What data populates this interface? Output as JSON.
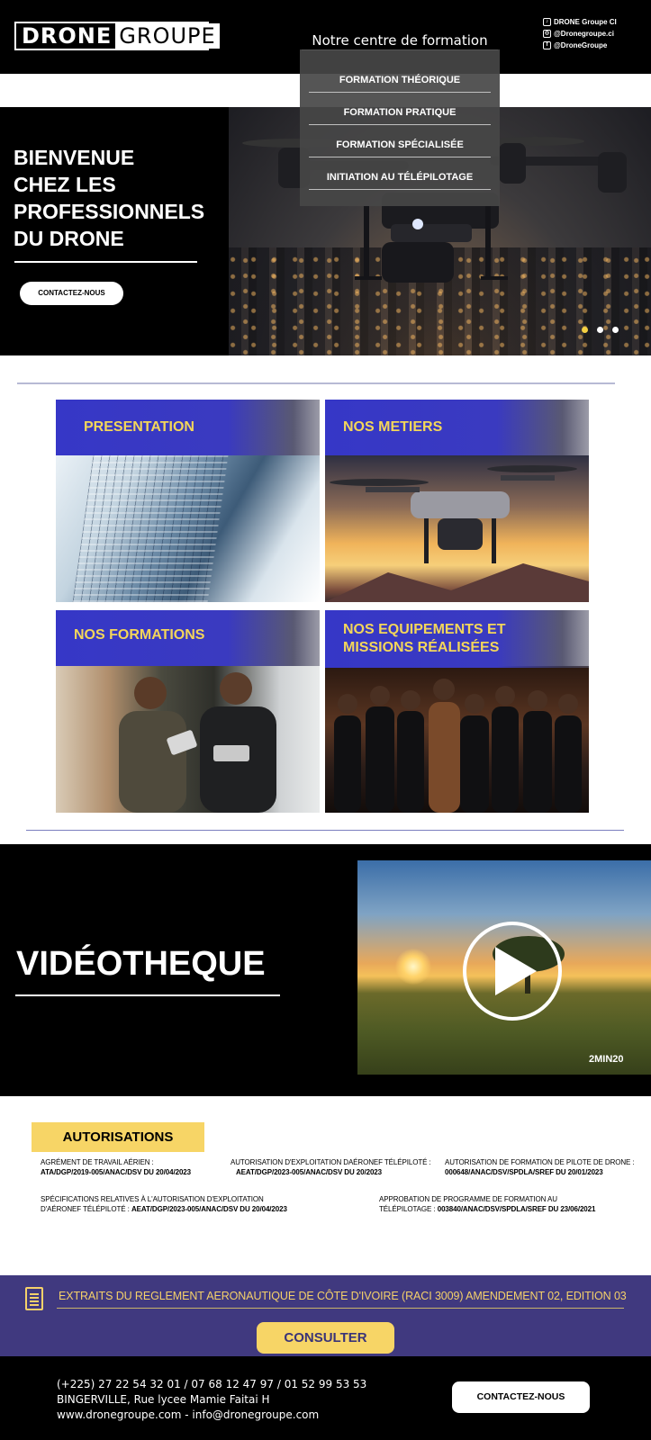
{
  "header": {
    "logo_part1": "DRONE",
    "logo_part2": "GROUPE",
    "nav_title": "Notre centre de formation",
    "socials": [
      {
        "icon": "tiktok-icon",
        "label": "DRONE Groupe CI"
      },
      {
        "icon": "instagram-icon",
        "label": "@Dronegroupe.ci"
      },
      {
        "icon": "facebook-icon",
        "label": "@DroneGroupe"
      }
    ]
  },
  "dropdown": {
    "items": [
      "FORMATION THÉORIQUE",
      "FORMATION PRATIQUE",
      "FORMATION SPÉCIALISÉE",
      "INITIATION AU TÉLÉPILOTAGE"
    ]
  },
  "hero": {
    "title_lines": [
      "BIENVENUE",
      "CHEZ LES",
      "PROFESSIONNELS",
      "DU DRONE"
    ],
    "cta_label": "CONTACTEZ-NOUS",
    "slide_count": 3,
    "active_slide": 1
  },
  "tiles": [
    {
      "label": "PRESENTATION"
    },
    {
      "label": "NOS METIERS"
    },
    {
      "label": "NOS FORMATIONS"
    },
    {
      "label_line1": "NOS EQUIPEMENTS ET",
      "label_line2": "MISSIONS RÉALISÉES"
    }
  ],
  "video": {
    "title": "VIDÉOTHEQUE",
    "duration": "2MIN20"
  },
  "authorizations": {
    "title": "AUTORISATIONS",
    "items": [
      {
        "label": "AGRÉMENT DE TRAVAIL AÉRIEN :",
        "value": "ATA/DGP/2019-005/ANAC/DSV DU 20/04/2023"
      },
      {
        "label": "AUTORISATION D'EXPLOITATION DAÉRONEF TÉLÉPILOTÉ :",
        "value": "AEAT/DGP/2023-005/ANAC/DSV DU 20/2023"
      },
      {
        "label": "AUTORISATION DE FORMATION DE PILOTE DE DRONE :",
        "value": "000648/ANAC/DSV/SPDLA/SREF DU 20/01/2023"
      },
      {
        "label": "SPÉCIFICATIONS RELATIVES À L'AUTORISATION D'EXPLOITATION",
        "label2": "D'AÉRONEF TÉLÉPILOTÉ :",
        "value": "AEAT/DGP/2023-005/ANAC/DSV DU 20/04/2023"
      },
      {
        "label": "APPROBATION DE PROGRAMME DE FORMATION AU",
        "label2": "TÉLÉPILOTAGE :",
        "value": "003840/ANAC/DSV/SPDLA/SREF DU 23/06/2021"
      }
    ]
  },
  "regulation": {
    "text": "EXTRAITS DU REGLEMENT AERONAUTIQUE DE CÔTE D'IVOIRE (RACI 3009) AMENDEMENT 02, EDITION 03",
    "button_label": "CONSULTER"
  },
  "footer": {
    "phones": "(+225) 27 22 54 32 01 / 07 68 12 47 97 / 01 52 99 53 53",
    "address": "BINGERVILLE, Rue lycee Mamie Faitai H",
    "web": "www.dronegroupe.com - info@dronegroupe.com",
    "cta_label": "CONTACTEZ-NOUS"
  },
  "colors": {
    "accent_yellow": "#f5d142",
    "tile_blue": "#3637c7",
    "band_purple": "#40397f"
  }
}
